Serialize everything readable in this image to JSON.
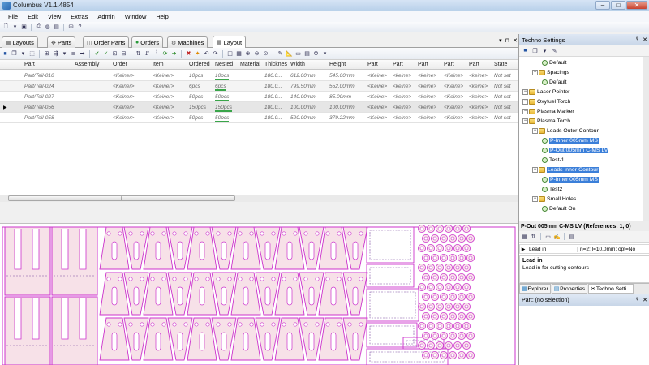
{
  "window": {
    "title": "Columbus V1.1.4854",
    "min": "–",
    "max": "□",
    "close": "✕"
  },
  "menu": [
    "File",
    "Edit",
    "View",
    "Extras",
    "Admin",
    "Window",
    "Help"
  ],
  "tabs": [
    {
      "label": "Layouts",
      "icon": "layouts-icon"
    },
    {
      "label": "Parts",
      "icon": "parts-icon"
    },
    {
      "label": "Order Parts",
      "icon": "order-parts-icon"
    },
    {
      "label": "Orders",
      "icon": "orders-icon"
    },
    {
      "label": "Machines",
      "icon": "machines-icon"
    },
    {
      "label": "Layout",
      "icon": "layout-icon",
      "active": true
    }
  ],
  "pane_controls": [
    "▾",
    "⊓",
    "✕"
  ],
  "grid": {
    "headers": [
      "Part",
      "Assembly",
      "Order",
      "Item",
      "Ordered",
      "Nested",
      "Material",
      "Thicknes",
      "Width",
      "Height",
      "Part",
      "Part",
      "Part",
      "Part",
      "Part",
      "State"
    ],
    "rows": [
      {
        "part": "Part/Teil-010",
        "order": "<Keiner>",
        "item": "<Keiner>",
        "ordered": "10pcs",
        "nested": "10pcs",
        "thickness": "180.0...",
        "width": "612.00mm",
        "height": "545.00mm",
        "p1": "<Keine>",
        "p2": "<keine>",
        "p3": "<keine>",
        "p4": "<Keine>",
        "p5": "<keine>",
        "state": "Not set"
      },
      {
        "part": "Part/Teil-024",
        "order": "<Keiner>",
        "item": "<Keiner>",
        "ordered": "6pcs",
        "nested": "6pcs",
        "thickness": "180.0...",
        "width": "799.50mm",
        "height": "552.00mm",
        "p1": "<Keine>",
        "p2": "<keine>",
        "p3": "<keine>",
        "p4": "<Keine>",
        "p5": "<keine>",
        "state": "Not set"
      },
      {
        "part": "Part/Teil-027",
        "order": "<Keiner>",
        "item": "<Keiner>",
        "ordered": "50pcs",
        "nested": "50pcs",
        "thickness": "180.0...",
        "width": "140.00mm",
        "height": "85.00mm",
        "p1": "<Keine>",
        "p2": "<keine>",
        "p3": "<keine>",
        "p4": "<Keine>",
        "p5": "<keine>",
        "state": "Not set"
      },
      {
        "part": "Part/Teil-056",
        "order": "<Keiner>",
        "item": "<Keiner>",
        "ordered": "150pcs",
        "nested": "150pcs",
        "thickness": "180.0...",
        "width": "100.00mm",
        "height": "100.00mm",
        "p1": "<Keine>",
        "p2": "<keine>",
        "p3": "<keine>",
        "p4": "<Keine>",
        "p5": "<keine>",
        "state": "Not set"
      },
      {
        "part": "Part/Teil-058",
        "order": "<Keiner>",
        "item": "<Keiner>",
        "ordered": "50pcs",
        "nested": "50pcs",
        "thickness": "180.0...",
        "width": "520.00mm",
        "height": "379.22mm",
        "p1": "<Keine>",
        "p2": "<keine>",
        "p3": "<keine>",
        "p4": "<Keine>",
        "p5": "<keine>",
        "state": "Not set"
      }
    ]
  },
  "techno": {
    "title": "Techno Settings",
    "panel_controls": [
      "ᵠ",
      "✕"
    ],
    "tree": [
      {
        "label": "Default",
        "level": 3,
        "type": "node"
      },
      {
        "label": "Spacings",
        "level": 2,
        "type": "folder"
      },
      {
        "label": "Default",
        "level": 3,
        "type": "node"
      },
      {
        "label": "Laser Pointer",
        "level": 1,
        "type": "folder"
      },
      {
        "label": "Oxyfuel Torch",
        "level": 1,
        "type": "folder"
      },
      {
        "label": "Plasma Marker",
        "level": 1,
        "type": "folder"
      },
      {
        "label": "Plasma Torch",
        "level": 1,
        "type": "folder"
      },
      {
        "label": "Leads Outer-Contour",
        "level": 2,
        "type": "folder"
      },
      {
        "label": "P-Inner 005mm MS",
        "level": 3,
        "type": "node",
        "highlight": true
      },
      {
        "label": "P-Out 005mm C-MS LV",
        "level": 3,
        "type": "node",
        "highlight": true
      },
      {
        "label": "Test-1",
        "level": 3,
        "type": "node"
      },
      {
        "label": "Leads Inner-Contour",
        "level": 2,
        "type": "folder",
        "highlight": true
      },
      {
        "label": "P-Inner 005mm MS",
        "level": 3,
        "type": "node",
        "highlight": true
      },
      {
        "label": "Test2",
        "level": 3,
        "type": "node"
      },
      {
        "label": "Small Holes",
        "level": 2,
        "type": "folder"
      },
      {
        "label": "Default On",
        "level": 3,
        "type": "node"
      }
    ]
  },
  "properties": {
    "header": "P-Out 005mm C-MS LV  (References: 1,  0)",
    "row_name": "Lead in",
    "row_value": "n=2; l=10.0mm; opt=No",
    "desc_title": "Lead in",
    "desc_text": "Lead in for cutting contours"
  },
  "bottom_tabs": [
    "Explorer",
    "Properties",
    "Techno Setti..."
  ],
  "part_panel": {
    "label": "Part: (no selection)",
    "controls": [
      "ᵠ",
      "✕"
    ]
  },
  "colors": {
    "sheet_line": "#cc33cc",
    "sheet_fill": "#f7e1e8",
    "detail": "#7a4aa0",
    "selection": "#3b7fd9"
  }
}
